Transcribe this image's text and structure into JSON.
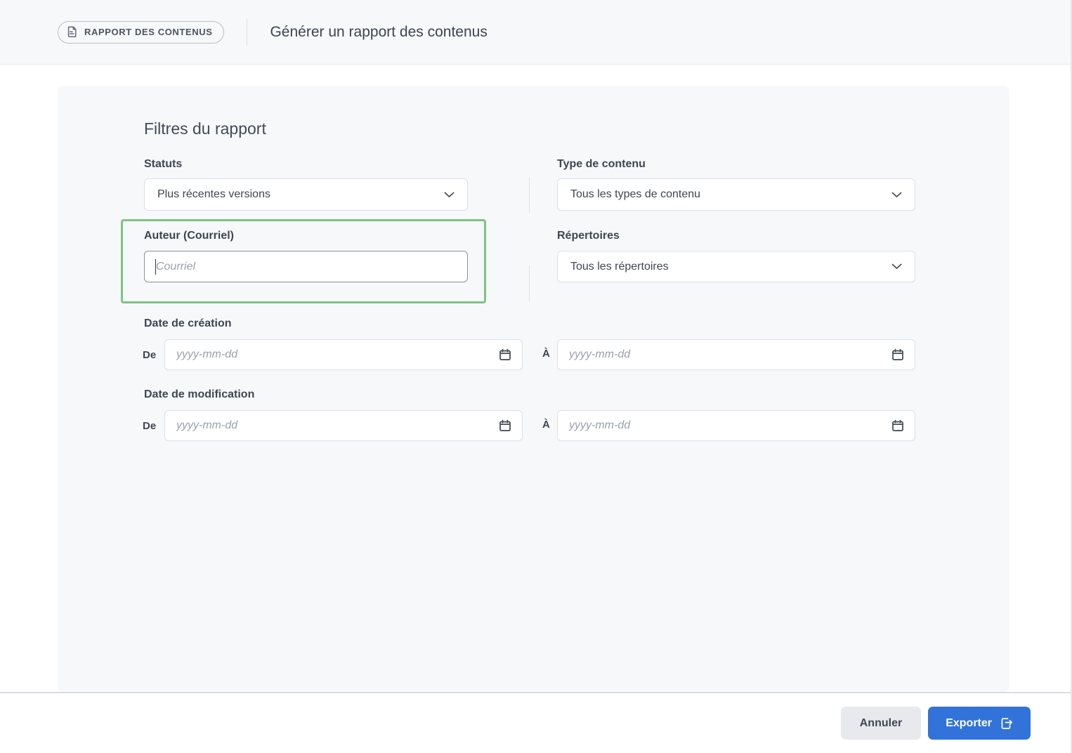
{
  "header": {
    "badge": {
      "label": "RAPPORT DES CONTENUS",
      "icon": "report-document-icon"
    },
    "title": "Générer un rapport des contenus"
  },
  "panel": {
    "heading": "Filtres du rapport",
    "statuts": {
      "label": "Statuts",
      "selected": "Plus récentes versions"
    },
    "type_contenu": {
      "label": "Type de contenu",
      "selected": "Tous les types de contenu"
    },
    "auteur": {
      "label": "Auteur (Courriel)",
      "value": "",
      "placeholder": "Courriel",
      "highlighted": true
    },
    "repertoires": {
      "label": "Répertoires",
      "selected": "Tous les répertoires"
    },
    "date_creation": {
      "label": "Date de création",
      "from_label": "De",
      "to_label": "À",
      "from_value": "",
      "to_value": "",
      "from_placeholder": "yyyy-mm-dd",
      "to_placeholder": "yyyy-mm-dd"
    },
    "date_modification": {
      "label": "Date de modification",
      "from_label": "De",
      "to_label": "À",
      "from_value": "",
      "to_value": "",
      "from_placeholder": "yyyy-mm-dd",
      "to_placeholder": "yyyy-mm-dd"
    }
  },
  "footer": {
    "cancel_label": "Annuler",
    "export_label": "Exporter",
    "export_icon": "export-file-arrow-icon"
  },
  "colors": {
    "highlight_green": "#7cc482",
    "primary_blue": "#3273d9",
    "panel_background": "#f7f8fa",
    "header_background": "#f7f8fa"
  }
}
